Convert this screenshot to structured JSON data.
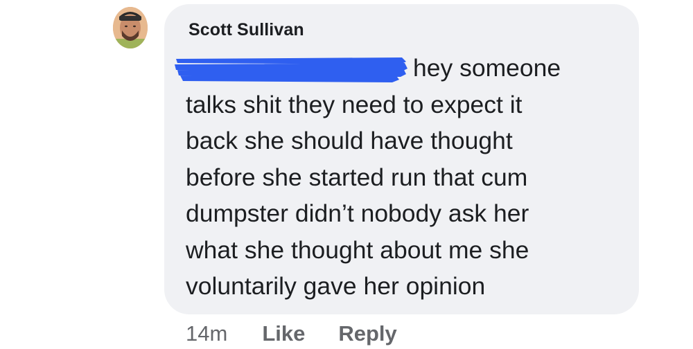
{
  "comment": {
    "author": "Scott Sullivan",
    "lines": [
      "hey someone",
      "talks shit they need to expect it",
      "back she should have thought",
      "before she started run that cum",
      "dumpster didn’t nobody ask her",
      "what she thought about me  she",
      "voluntarily gave her opinion"
    ],
    "redaction_color": "#2f5ff0",
    "avatar_icon": "profile-photo-icon"
  },
  "actions": {
    "time": "14m",
    "like_label": "Like",
    "reply_label": "Reply"
  }
}
